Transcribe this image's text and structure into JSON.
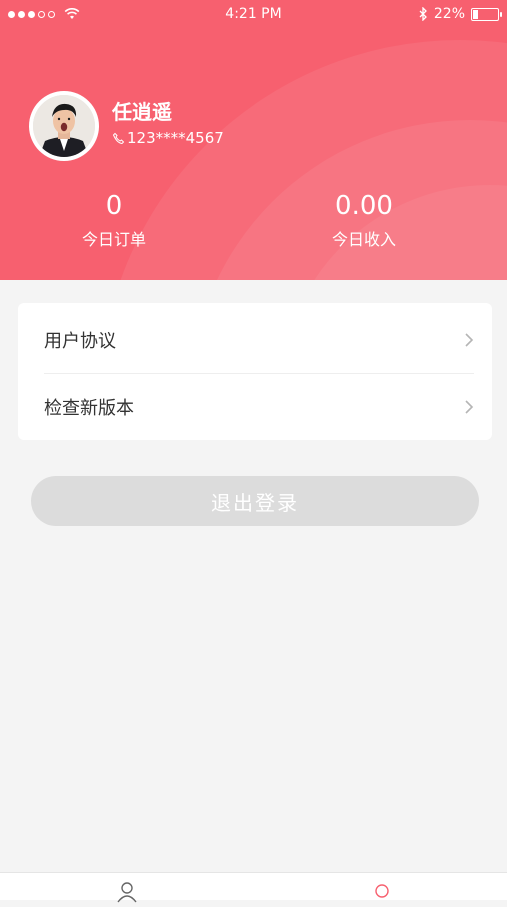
{
  "status_bar": {
    "time": "4:21 PM",
    "battery": "22%",
    "battery_level": 0.22,
    "signal_icon": "signal-dots",
    "wifi_icon": "wifi-icon",
    "bluetooth_icon": "bluetooth-icon"
  },
  "profile": {
    "name": "任逍遥",
    "phone": "123****4567",
    "phone_icon": "phone-icon"
  },
  "stats": {
    "orders_value": "0",
    "orders_label": "今日订单",
    "income_value": "0.00",
    "income_label": "今日收入"
  },
  "menu": {
    "items": [
      {
        "label": "用户协议"
      },
      {
        "label": "检查新版本"
      }
    ]
  },
  "logout_label": "退出登录",
  "colors": {
    "header": "#f7606f",
    "background": "#f4f4f4",
    "button": "#dcdcdc",
    "tab_active": "#f7606f"
  },
  "tabs": [
    {
      "icon": "user-outline-icon",
      "active": false
    },
    {
      "icon": "circle-icon",
      "active": true
    }
  ]
}
